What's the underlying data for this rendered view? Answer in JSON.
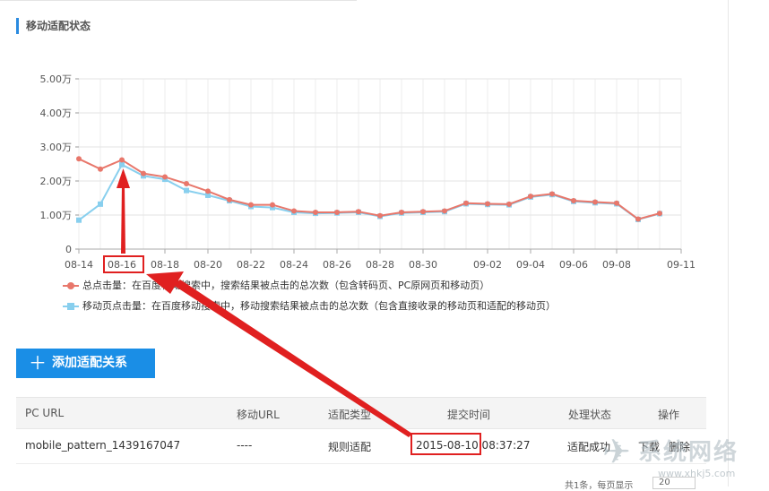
{
  "section": {
    "title": "移动适配状态"
  },
  "chart_data": {
    "type": "line",
    "x": [
      "08-14",
      "08-15",
      "08-16",
      "08-17",
      "08-18",
      "08-19",
      "08-20",
      "08-21",
      "08-22",
      "08-23",
      "08-24",
      "08-25",
      "08-26",
      "08-27",
      "08-28",
      "08-29",
      "08-30",
      "08-31",
      "09-01",
      "09-02",
      "09-03",
      "09-04",
      "09-05",
      "09-06",
      "09-07",
      "09-08",
      "09-09",
      "09-10",
      "09-11"
    ],
    "xticks": [
      "08-14",
      "08-16",
      "08-18",
      "08-20",
      "08-22",
      "08-24",
      "08-26",
      "08-28",
      "08-30",
      "09-02",
      "09-04",
      "09-06",
      "09-08",
      "09-11"
    ],
    "yticks": [
      "0",
      "1.00万",
      "2.00万",
      "3.00万",
      "4.00万",
      "5.00万"
    ],
    "ylim": [
      0,
      5
    ],
    "grid": true,
    "legend_position": "bottom",
    "series": [
      {
        "name": "总点击量：在百度移动搜索中，搜索结果被点击的总次数（包含转码页、PC原网页和移动页）",
        "color": "#e8776b",
        "marker": "circle",
        "values": [
          2.65,
          2.35,
          2.62,
          2.22,
          2.12,
          1.92,
          1.7,
          1.45,
          1.3,
          1.3,
          1.12,
          1.08,
          1.08,
          1.1,
          0.98,
          1.08,
          1.1,
          1.12,
          1.35,
          1.33,
          1.32,
          1.55,
          1.62,
          1.42,
          1.38,
          1.35,
          0.88,
          1.05
        ]
      },
      {
        "name": "移动页点击量：在百度移动搜索中，移动搜索结果被点击的总次数（包含直接收录的移动页和适配的移动页）",
        "color": "#88cfee",
        "marker": "square",
        "values": [
          0.85,
          1.32,
          2.48,
          2.15,
          2.05,
          1.72,
          1.58,
          1.42,
          1.25,
          1.22,
          1.08,
          1.05,
          1.06,
          1.08,
          0.96,
          1.06,
          1.08,
          1.1,
          1.33,
          1.31,
          1.3,
          1.53,
          1.6,
          1.4,
          1.36,
          1.33,
          0.87,
          1.04
        ]
      }
    ]
  },
  "add_button": {
    "label": "添加适配关系",
    "icon": "plus-icon"
  },
  "table": {
    "headers": [
      "PC URL",
      "移动URL",
      "适配类型",
      "提交时间",
      "处理状态",
      "操作"
    ],
    "row": {
      "pc_url": "mobile_pattern_1439167047",
      "mobile_url": "----",
      "type": "规则适配",
      "submit_time": "2015-08-10 08:37:27",
      "status": "适配成功",
      "op_download": "下载",
      "op_delete": "删除"
    }
  },
  "pagination": {
    "text": "共1条，每页显示",
    "page_size": "20"
  },
  "watermark": {
    "brand": "系统网络",
    "url": "www.xhkj5.com"
  },
  "colors": {
    "accent": "#1a8ee6",
    "annotation": "#e02020"
  }
}
